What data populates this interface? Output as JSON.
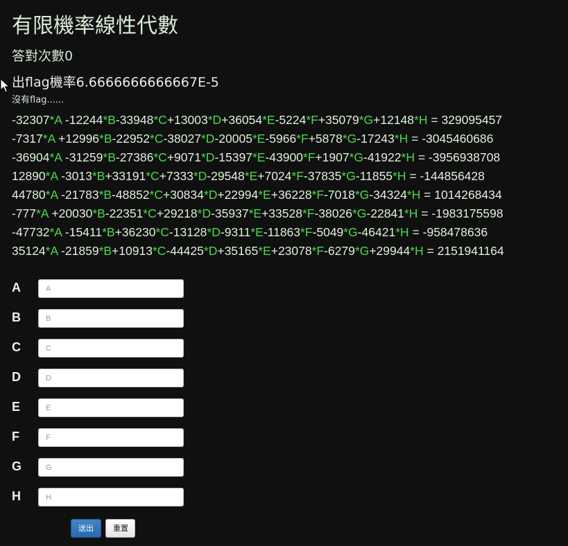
{
  "page": {
    "title": "有限機率線性代數",
    "count_label": "答對次數0",
    "probability_label": "出flag機率6.6666666666667E-5",
    "flag_status": "沒有flag......"
  },
  "colors": {
    "background": "#101010",
    "variable": "#4cd94c",
    "text": "#dff0dc",
    "primary_button": "#337ab7"
  },
  "variables": [
    "A",
    "B",
    "C",
    "D",
    "E",
    "F",
    "G",
    "H"
  ],
  "equations": [
    {
      "coefficients": [
        "-32307",
        " -12244",
        "-33948",
        "+13003",
        "+36054",
        "-5224",
        "+35079",
        "+12148"
      ],
      "result": "329095457"
    },
    {
      "coefficients": [
        "-7317",
        " +12996",
        "-22952",
        "-38027",
        "-20005",
        "-5966",
        "+5878",
        "-17243"
      ],
      "result": "-3045460686"
    },
    {
      "coefficients": [
        "-36904",
        " -31259",
        "-27386",
        "+9071",
        "-15397",
        "-43900",
        "+1907",
        "-41922"
      ],
      "result": "-3956938708"
    },
    {
      "coefficients": [
        "12890",
        " -3013",
        "+33191",
        "+7333",
        "-29548",
        "+7024",
        "-37835",
        "-11855"
      ],
      "result": "-144856428"
    },
    {
      "coefficients": [
        "44780",
        " -21783",
        "-48852",
        "+30834",
        "+22994",
        "+36228",
        "-7018",
        "-34324"
      ],
      "result": "1014268434"
    },
    {
      "coefficients": [
        "-777",
        " +20030",
        "-22351",
        "+29218",
        "-35937",
        "+33528",
        "-38026",
        "-22841"
      ],
      "result": "-1983175598"
    },
    {
      "coefficients": [
        "-47732",
        " -15411",
        "+36230",
        "-13128",
        "-9311",
        "-11863",
        "-5049",
        "-46421"
      ],
      "result": "-958478636"
    },
    {
      "coefficients": [
        "35124",
        " -21859",
        "+10913",
        "-44425",
        "+35165",
        "+23078",
        "-6279",
        "+29944"
      ],
      "result": "2151941164"
    }
  ],
  "form": {
    "fields": [
      {
        "label": "A",
        "placeholder": "A",
        "value": ""
      },
      {
        "label": "B",
        "placeholder": "B",
        "value": ""
      },
      {
        "label": "C",
        "placeholder": "C",
        "value": ""
      },
      {
        "label": "D",
        "placeholder": "D",
        "value": ""
      },
      {
        "label": "E",
        "placeholder": "E",
        "value": ""
      },
      {
        "label": "F",
        "placeholder": "F",
        "value": ""
      },
      {
        "label": "G",
        "placeholder": "G",
        "value": ""
      },
      {
        "label": "H",
        "placeholder": "H",
        "value": ""
      }
    ],
    "submit_label": "送出",
    "reset_label": "重置"
  },
  "icons": {
    "cursor": "mouse-pointer-icon"
  }
}
